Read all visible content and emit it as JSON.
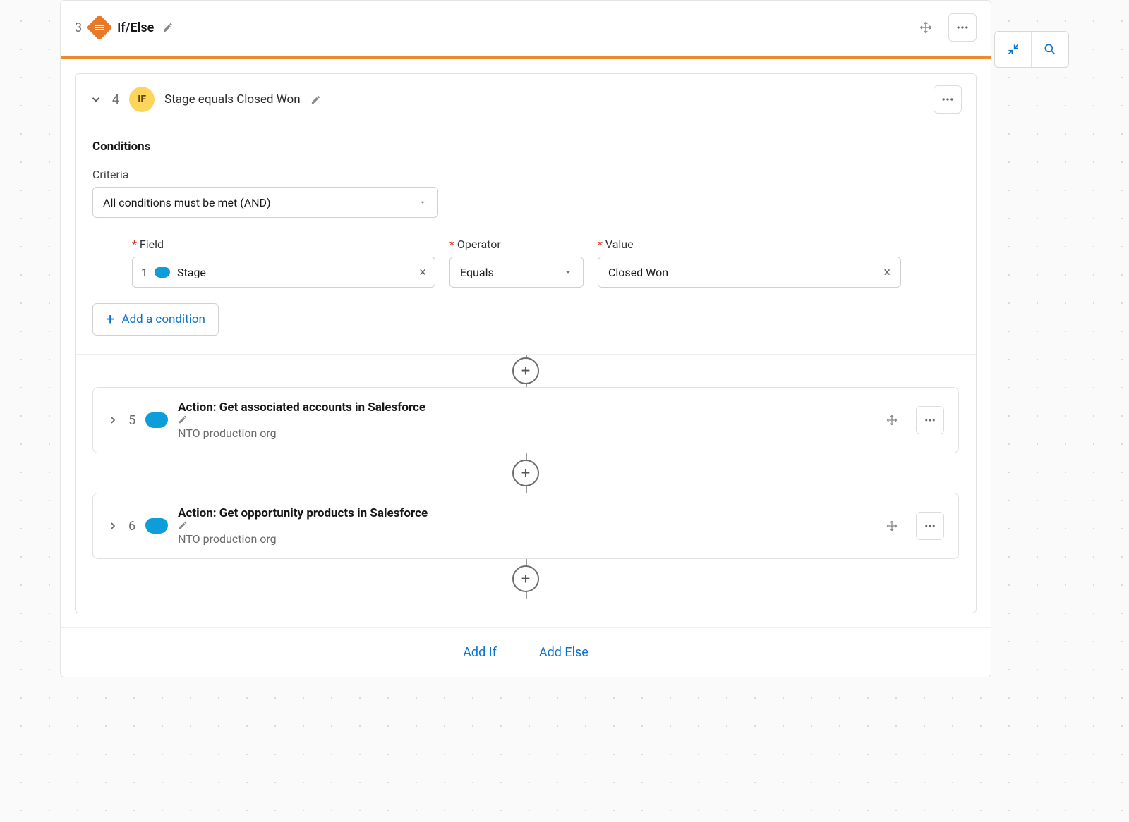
{
  "header": {
    "step_number": "3",
    "title": "If/Else"
  },
  "if": {
    "step_number": "4",
    "badge": "IF",
    "description": "Stage equals Closed Won"
  },
  "conditions": {
    "heading": "Conditions",
    "criteria_label": "Criteria",
    "criteria_value": "All conditions must be met (AND)",
    "labels": {
      "field": "Field",
      "operator": "Operator",
      "value": "Value"
    },
    "row": {
      "field_source_step": "1",
      "field_name": "Stage",
      "operator": "Equals",
      "value": "Closed Won"
    },
    "add_condition": "Add a condition"
  },
  "actions": [
    {
      "step_number": "5",
      "title": "Action: Get associated accounts in Salesforce",
      "subtitle": "NTO production org"
    },
    {
      "step_number": "6",
      "title": "Action: Get opportunity products in Salesforce",
      "subtitle": "NTO production org"
    }
  ],
  "footer": {
    "add_if": "Add If",
    "add_else": "Add Else"
  }
}
